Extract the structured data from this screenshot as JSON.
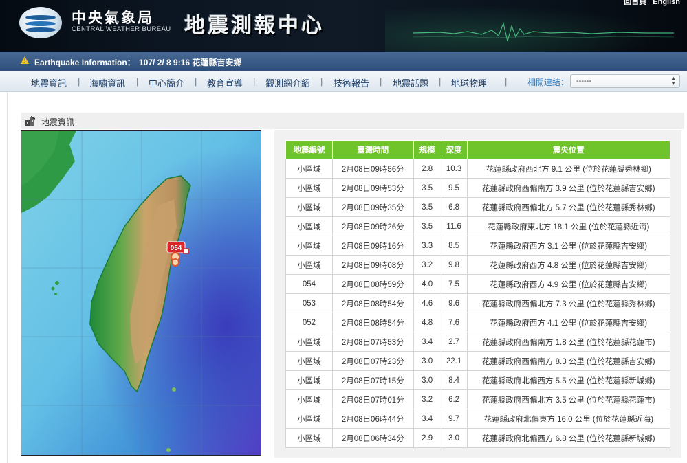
{
  "header": {
    "org_name_zh": "中央氣象局",
    "org_name_en": "CENTRAL WEATHER BUREAU",
    "site_title": "地震測報中心",
    "lang_links": [
      "回首頁",
      "English"
    ]
  },
  "info_bar": {
    "label": "Earthquake Information：",
    "value": "107/ 2/ 8 9:16 花蓮縣吉安鄉"
  },
  "nav": {
    "items": [
      "地震資訊",
      "海嘯資訊",
      "中心簡介",
      "教育宣導",
      "觀測網介紹",
      "技術報告",
      "地震話題",
      "地球物理"
    ],
    "separator": "|",
    "related_label": "相關連結：",
    "related_selected": "------"
  },
  "section": {
    "title": "地震資訊"
  },
  "map": {
    "marker_label": "054"
  },
  "table": {
    "headers": [
      "地震編號",
      "臺灣時間",
      "規模",
      "深度",
      "震央位置"
    ],
    "rows": [
      {
        "id": "小區域",
        "time": "2月08日09時56分",
        "mag": "2.8",
        "depth": "10.3",
        "loc": "花蓮縣政府西北方 9.1 公里 (位於花蓮縣秀林鄉)"
      },
      {
        "id": "小區域",
        "time": "2月08日09時53分",
        "mag": "3.5",
        "depth": "9.5",
        "loc": "花蓮縣政府西偏南方 3.9 公里 (位於花蓮縣吉安鄉)"
      },
      {
        "id": "小區域",
        "time": "2月08日09時35分",
        "mag": "3.5",
        "depth": "6.8",
        "loc": "花蓮縣政府西偏北方 5.7 公里 (位於花蓮縣秀林鄉)"
      },
      {
        "id": "小區域",
        "time": "2月08日09時26分",
        "mag": "3.5",
        "depth": "11.6",
        "loc": "花蓮縣政府東北方 18.1 公里 (位於花蓮縣近海)"
      },
      {
        "id": "小區域",
        "time": "2月08日09時16分",
        "mag": "3.3",
        "depth": "8.5",
        "loc": "花蓮縣政府西方 3.1 公里 (位於花蓮縣吉安鄉)"
      },
      {
        "id": "小區域",
        "time": "2月08日09時08分",
        "mag": "3.2",
        "depth": "9.8",
        "loc": "花蓮縣政府西方 4.8 公里 (位於花蓮縣吉安鄉)"
      },
      {
        "id": "054",
        "time": "2月08日08時59分",
        "mag": "4.0",
        "depth": "7.5",
        "loc": "花蓮縣政府西方 4.9 公里 (位於花蓮縣吉安鄉)"
      },
      {
        "id": "053",
        "time": "2月08日08時54分",
        "mag": "4.6",
        "depth": "9.6",
        "loc": "花蓮縣政府西偏北方 7.3 公里 (位於花蓮縣秀林鄉)"
      },
      {
        "id": "052",
        "time": "2月08日08時54分",
        "mag": "4.8",
        "depth": "7.6",
        "loc": "花蓮縣政府西方 4.1 公里 (位於花蓮縣吉安鄉)"
      },
      {
        "id": "小區域",
        "time": "2月08日07時53分",
        "mag": "3.4",
        "depth": "2.7",
        "loc": "花蓮縣政府西偏南方 1.8 公里 (位於花蓮縣花蓮市)"
      },
      {
        "id": "小區域",
        "time": "2月08日07時23分",
        "mag": "3.0",
        "depth": "22.1",
        "loc": "花蓮縣政府西偏南方 8.3 公里 (位於花蓮縣吉安鄉)"
      },
      {
        "id": "小區域",
        "time": "2月08日07時15分",
        "mag": "3.0",
        "depth": "8.4",
        "loc": "花蓮縣政府北偏西方 5.5 公里 (位於花蓮縣新城鄉)"
      },
      {
        "id": "小區域",
        "time": "2月08日07時01分",
        "mag": "3.2",
        "depth": "6.2",
        "loc": "花蓮縣政府西偏北方 3.5 公里 (位於花蓮縣花蓮市)"
      },
      {
        "id": "小區域",
        "time": "2月08日06時44分",
        "mag": "3.4",
        "depth": "9.7",
        "loc": "花蓮縣政府北偏東方 16.0 公里 (位於花蓮縣近海)"
      },
      {
        "id": "小區域",
        "time": "2月08日06時34分",
        "mag": "2.9",
        "depth": "3.0",
        "loc": "花蓮縣政府北偏西方 6.8 公里 (位於花蓮縣新城鄉)"
      }
    ]
  },
  "colors": {
    "header_bg": "#0c1622",
    "infobar_bg": "#3a5b86",
    "nav_text": "#1d3f6a",
    "table_header_bg": "#6fc42b",
    "marker_red": "#d9262a"
  }
}
